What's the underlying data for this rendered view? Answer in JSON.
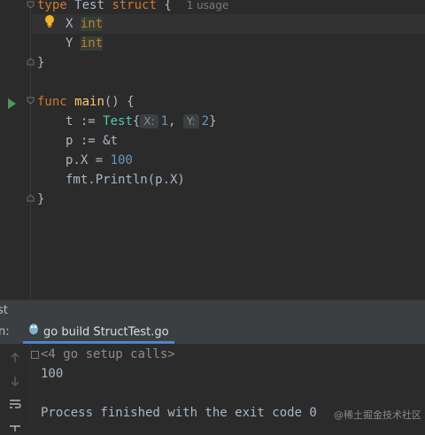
{
  "editor": {
    "line1": {
      "kw_type": "type",
      "name": "Test",
      "kw_struct": "struct",
      "brace": "{",
      "usage": "1 usage"
    },
    "line2": {
      "field": "X",
      "type": "int"
    },
    "line3": {
      "field": "Y",
      "type": "int"
    },
    "line4": {
      "brace": "}"
    },
    "line6": {
      "kw_func": "func",
      "name": "main",
      "rest": "() {"
    },
    "line7": {
      "lhs": "t := ",
      "type": "Test",
      "open": "{",
      "hint_x": "X:",
      "val1": "1",
      "comma": ",",
      "hint_y": "Y:",
      "val2": "2",
      "close": "}"
    },
    "line8": {
      "text": "p := &t"
    },
    "line9": {
      "lhs": "p.X = ",
      "val": "100"
    },
    "line10": {
      "text": "fmt.Println(p.X)"
    },
    "line11": {
      "brace": "}"
    }
  },
  "tool_window": {
    "title": "st",
    "run_label": "n:",
    "tab_label": "go build StructTest.go"
  },
  "console": {
    "collapsed_line": "<4 go setup calls>",
    "output": "100",
    "finish": "Process finished with the exit code 0"
  },
  "watermark": "@稀土掘金技术社区",
  "colors": {
    "keyword": "#cc7832",
    "function": "#ffc66d",
    "type": "#4ec9b0",
    "number": "#6897bb",
    "text": "#a9b7c6",
    "background": "#2b2b2b",
    "accent_tab": "#4a88c7",
    "run_icon": "#499c54"
  },
  "icons": {
    "bulb": "lightbulb-icon",
    "run": "run-gutter-icon",
    "go_file": "go-gopher-icon"
  }
}
